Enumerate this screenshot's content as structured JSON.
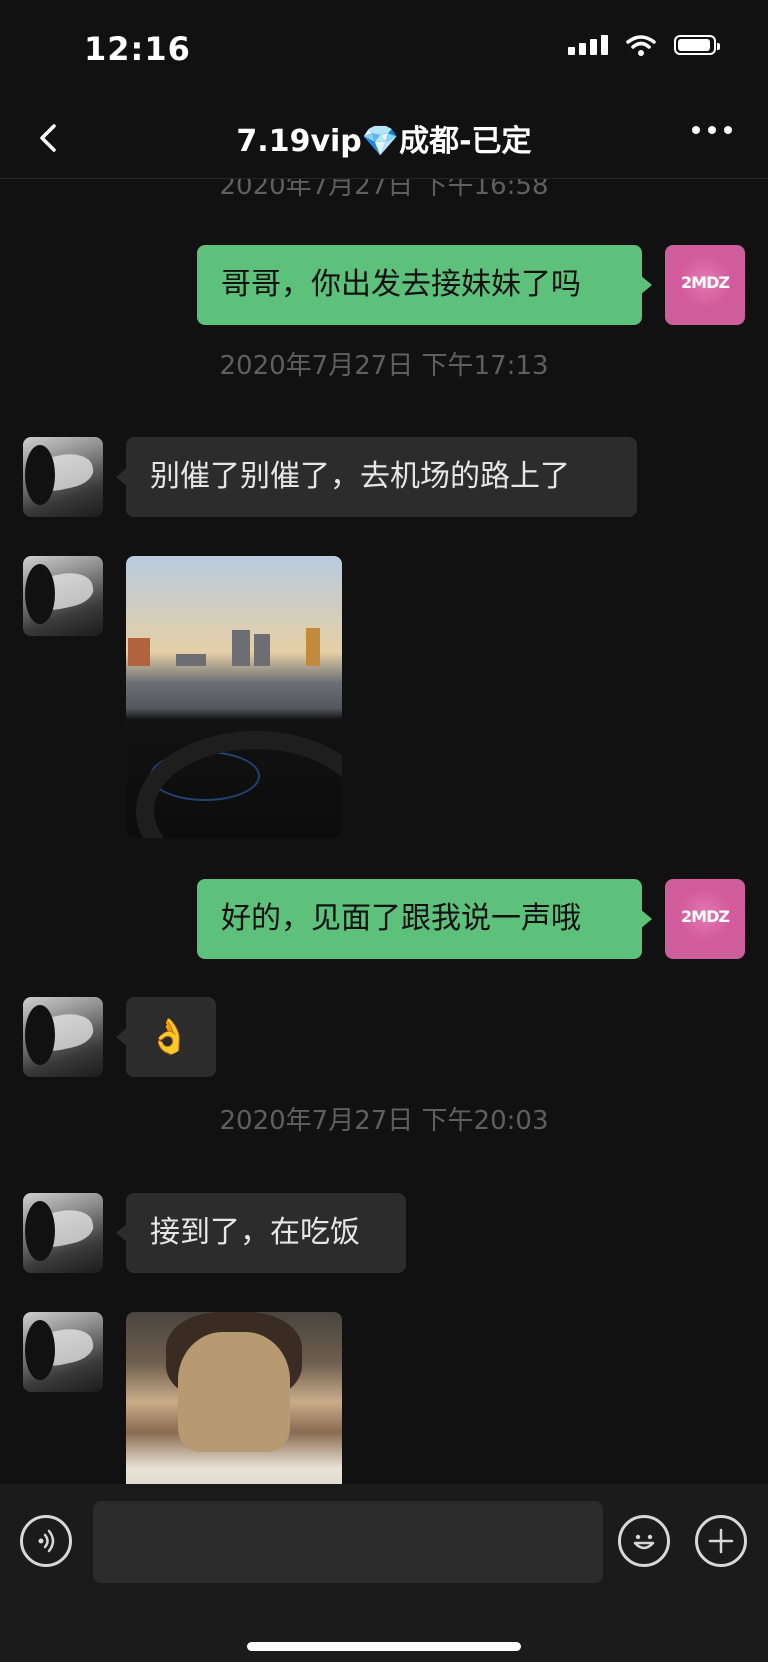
{
  "status_bar": {
    "time": "12:16"
  },
  "header": {
    "title": "7.19vip💎成都-已定"
  },
  "messages": {
    "ts_partial": "2020年7月27日 下午16:58",
    "m1": "哥哥，你出发去接妹妹了吗",
    "ts1": "2020年7月27日 下午17:13",
    "m2": "别催了别催了，去机场的路上了",
    "m3": "好的，见面了跟我说一声哦",
    "m4": "👌",
    "ts2": "2020年7月27日 下午20:03",
    "m5": "接到了，在吃饭"
  },
  "avatar_logo": "2MDZ",
  "input": {
    "placeholder": ""
  },
  "icons": {
    "voice": "voice-icon",
    "emoji": "emoji-icon",
    "plus": "plus-icon"
  },
  "colors": {
    "sent_bubble": "#5ec17b",
    "received_bubble": "#2c2c2c",
    "background": "#111111"
  }
}
